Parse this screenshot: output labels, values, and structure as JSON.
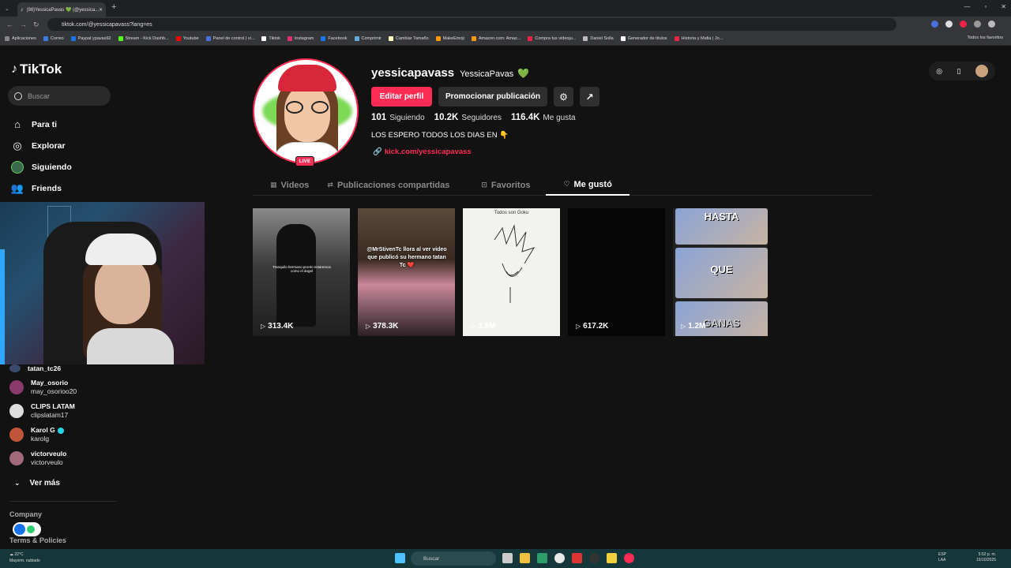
{
  "browser": {
    "tab_title": "(98)YessicaPavas 💚 (@yessica...",
    "url": "tiktok.com/@yessicapavass?lang=es",
    "bookmarks": [
      "Aplicaciones",
      "Correo",
      "Paypal ypavas92",
      "Stream - Kick Dashb...",
      "Youtube",
      "Panel de control | vi...",
      "Tiktok",
      "Instagram",
      "Facebook",
      "Comprimir",
      "Cambiar Tamaño",
      "MakeEmoji",
      "Amazon.com: Amaz...",
      "Compra tus videoju...",
      "Daniel Solla",
      "Generador de titulos",
      "Historia y Mafia | Jo..."
    ],
    "bookmarks_right": "Todos los favoritos"
  },
  "sidebar": {
    "logo": "TikTok",
    "search_placeholder": "Buscar",
    "nav": [
      {
        "label": "Para ti",
        "icon": "home-icon"
      },
      {
        "label": "Explorar",
        "icon": "compass-icon"
      },
      {
        "label": "Siguiendo",
        "icon": "following-avatar-icon"
      },
      {
        "label": "Friends",
        "icon": "friends-icon"
      }
    ],
    "following": [
      {
        "name": "",
        "handle": "tatan_tc26",
        "color": "#3a4a6a"
      },
      {
        "name": "May_osorio",
        "handle": "may_osorioo20",
        "color": "#8a3a6a"
      },
      {
        "name": "CLIPS LATAM",
        "handle": "clipslatam17",
        "color": "#ddd"
      },
      {
        "name": "Karol G",
        "handle": "karolg",
        "color": "#c0553a",
        "verified": true
      },
      {
        "name": "victorveulo",
        "handle": "victorveulo",
        "color": "#a06a7a"
      }
    ],
    "see_more": "Ver más",
    "company": "Company",
    "terms": "Terms & Policies"
  },
  "profile": {
    "username": "yessicapavass",
    "display_name": "YessicaPavas",
    "live_badge": "LIVE",
    "edit_button": "Editar perfil",
    "promote_button": "Promocionar publicación",
    "stats": {
      "following_count": "101",
      "following_label": "Siguiendo",
      "followers_count": "10.2K",
      "followers_label": "Seguidores",
      "likes_count": "116.4K",
      "likes_label": "Me gusta"
    },
    "bio": "LOS ESPERO TODOS LOS DIAS EN 👇",
    "link": "kick.com/yessicapavass"
  },
  "tabs": [
    {
      "label": "Videos",
      "icon": "grid-icon"
    },
    {
      "label": "Publicaciones compartidas",
      "icon": "repost-icon"
    },
    {
      "label": "Favoritos",
      "icon": "bookmark-icon"
    },
    {
      "label": "Me gustó",
      "icon": "heart-icon",
      "active": true
    }
  ],
  "videos": [
    {
      "views": "313.4K",
      "caption": "Tranquilo hermano pronto estaremos como el ángel"
    },
    {
      "views": "378.3K",
      "caption": "@MrStivenTc llora al ver video que publicó su hermano tatan Tc ❤️"
    },
    {
      "views": "3.6M",
      "caption": "Todos son Goku"
    },
    {
      "views": "617.2K",
      "caption": ""
    },
    {
      "views": "1.2M",
      "words": [
        "HASTA",
        "QUE",
        "GANAS"
      ]
    }
  ]
}
